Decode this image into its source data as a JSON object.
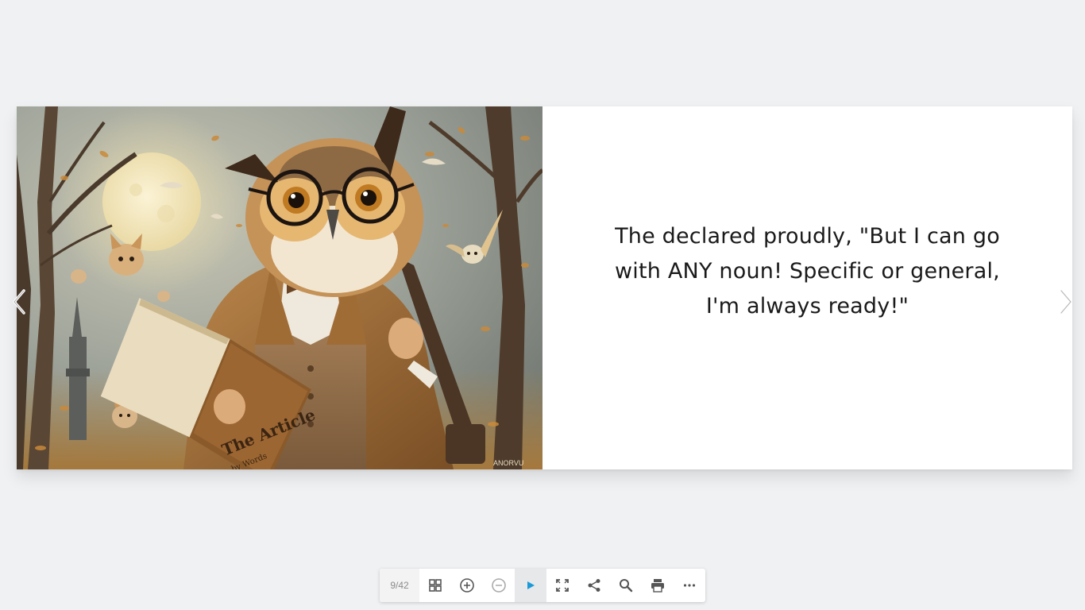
{
  "viewer": {
    "page_counter": "9/42",
    "current_page": 9,
    "total_pages": 42
  },
  "spread": {
    "left_page": {
      "illustration": "owl-reading-book-illustration",
      "book_title": "The Article",
      "book_subtitle": "by Words",
      "signature": "ANORVU"
    },
    "right_page": {
      "text": "The declared proudly, \"But I can go with ANY noun! Specific or general, I'm always ready!\""
    }
  },
  "navigation": {
    "prev_icon": "chevron-left-icon",
    "next_icon": "chevron-right-icon"
  },
  "toolbar": {
    "buttons": [
      {
        "name": "thumbnails",
        "icon": "grid-icon"
      },
      {
        "name": "zoom-in",
        "icon": "zoom-in-icon"
      },
      {
        "name": "zoom-out",
        "icon": "zoom-out-icon"
      },
      {
        "name": "autoplay",
        "icon": "play-icon"
      },
      {
        "name": "fullscreen",
        "icon": "fullscreen-icon"
      },
      {
        "name": "share",
        "icon": "share-icon"
      },
      {
        "name": "search",
        "icon": "search-icon"
      },
      {
        "name": "print",
        "icon": "print-icon"
      },
      {
        "name": "more",
        "icon": "more-icon"
      }
    ]
  },
  "colors": {
    "background": "#f0f1f3",
    "play_accent": "#1a9bd7",
    "icon": "#555555"
  }
}
